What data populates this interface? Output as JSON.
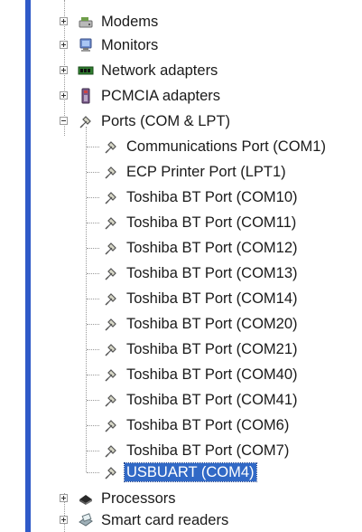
{
  "tree": {
    "categories_top": [
      {
        "label": "Modems",
        "icon": "modem-icon"
      },
      {
        "label": "Monitors",
        "icon": "monitor-icon"
      },
      {
        "label": "Network adapters",
        "icon": "network-adapter-icon"
      },
      {
        "label": "PCMCIA adapters",
        "icon": "pcmcia-icon"
      }
    ],
    "ports": {
      "label": "Ports (COM & LPT)",
      "icon": "port-connector-icon",
      "children": [
        {
          "label": "Communications Port (COM1)"
        },
        {
          "label": "ECP Printer Port (LPT1)"
        },
        {
          "label": "Toshiba BT Port (COM10)"
        },
        {
          "label": "Toshiba BT Port (COM11)"
        },
        {
          "label": "Toshiba BT Port (COM12)"
        },
        {
          "label": "Toshiba BT Port (COM13)"
        },
        {
          "label": "Toshiba BT Port (COM14)"
        },
        {
          "label": "Toshiba BT Port (COM20)"
        },
        {
          "label": "Toshiba BT Port (COM21)"
        },
        {
          "label": "Toshiba BT Port (COM40)"
        },
        {
          "label": "Toshiba BT Port (COM41)"
        },
        {
          "label": "Toshiba BT Port (COM6)"
        },
        {
          "label": "Toshiba BT Port (COM7)"
        },
        {
          "label": "USBUART (COM4)",
          "selected": true
        }
      ]
    },
    "categories_bottom": [
      {
        "label": "Processors",
        "icon": "processor-icon"
      },
      {
        "label": "Smart card readers",
        "icon": "smart-card-reader-icon"
      }
    ]
  },
  "colors": {
    "selection": "#3169c6",
    "sidebar_accent": "#2f5ac8"
  }
}
